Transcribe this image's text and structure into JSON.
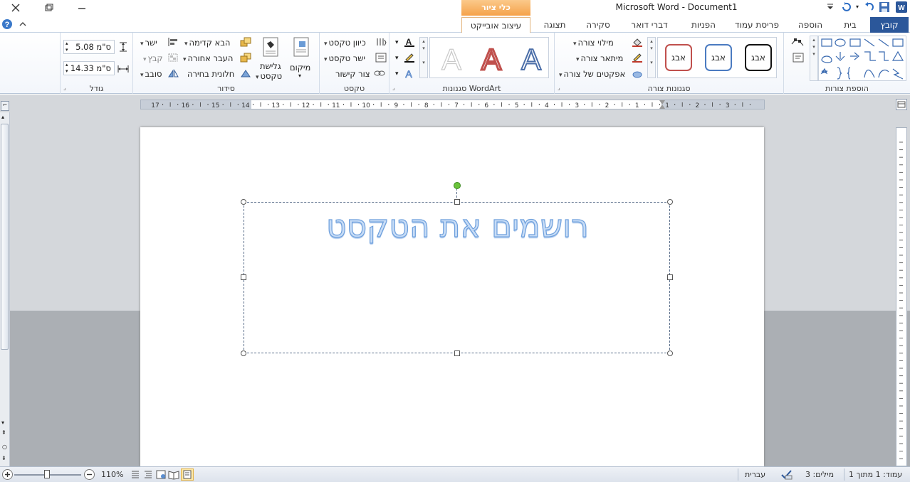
{
  "titlebar": {
    "app_title": "Microsoft Word - Document1",
    "context_label": "כלי ציור"
  },
  "tabs": [
    {
      "label": "קובץ"
    },
    {
      "label": "בית"
    },
    {
      "label": "הוספה"
    },
    {
      "label": "פריסת עמוד"
    },
    {
      "label": "הפניות"
    },
    {
      "label": "דברי דואר"
    },
    {
      "label": "סקירה"
    },
    {
      "label": "תצוגה"
    },
    {
      "label": "עיצוב אובייקט"
    }
  ],
  "groups": {
    "insert_shapes": "הוספת צורות",
    "shape_styles": "סגנונות צורה",
    "wordart_styles": "סגנונות WordArt",
    "text": "טקסט",
    "arrange": "סידור",
    "size": "גודל"
  },
  "shape_styles": {
    "preview_text": "אבג",
    "fill": "מילוי צורה",
    "outline": "מיתאר צורה",
    "effects": "אפקטים של צורה"
  },
  "wordart": {
    "preview_letter": "A"
  },
  "text_group": {
    "direction": "כיוון טקסט",
    "align": "ישר טקסט",
    "link": "צור קישור"
  },
  "arrange": {
    "position": "מיקום",
    "wrap_line1": "גלישת",
    "wrap_line2": "טקסט",
    "bring_forward": "הבא קדימה",
    "send_backward": "העבר אחורה",
    "selection_pane": "חלונית בחירה",
    "align": "ישר",
    "group": "קבץ",
    "rotate": "סובב"
  },
  "size": {
    "height": "5.08 ס\"מ",
    "width": "14.33 ס\"מ"
  },
  "document": {
    "wordart_text": "רושמים את הטקסט"
  },
  "ruler": {
    "labels": [
      "17",
      "16",
      "15",
      "14",
      "13",
      "12",
      "11",
      "10",
      "9",
      "8",
      "7",
      "6",
      "5",
      "4",
      "3",
      "2",
      "1",
      "1",
      "2",
      "3"
    ]
  },
  "status": {
    "page": "עמוד: 1 מתוך 1",
    "words": "מילים: 3",
    "language": "עברית",
    "zoom": "110%"
  },
  "colors": {
    "accent": "#2b579a",
    "context_tab": "#f7a34b",
    "wordart_blue": "#7fb1e8"
  }
}
